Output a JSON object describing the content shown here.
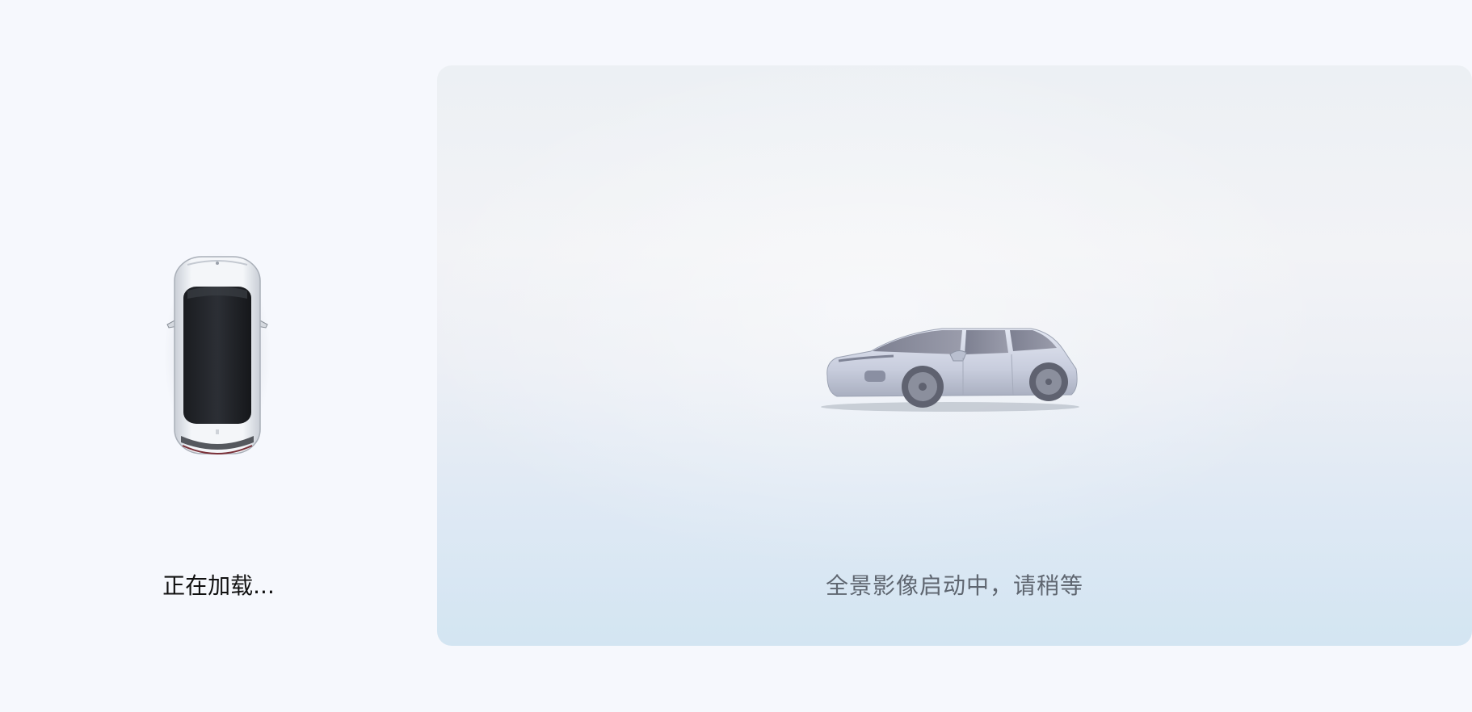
{
  "left_panel": {
    "car_icon": "car-top-view-icon",
    "loading_label": "正在加载..."
  },
  "view_panel": {
    "car_icon": "car-side-view-icon",
    "status_label": "全景影像启动中，请稍等"
  },
  "colors": {
    "background": "#f6f8fd",
    "panel_top": "#ecf0f4",
    "panel_bottom": "#d3e5f2",
    "status_text": "#5f6670",
    "loading_text": "#111111"
  }
}
